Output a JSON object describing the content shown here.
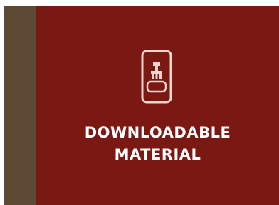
{
  "card": {
    "title_line1": "DOWNLOADABLE",
    "title_line2": "MATERIAL",
    "icon": "stamp-icon",
    "colors": {
      "background": "#7a1914",
      "edge_strip": "#5e4a34",
      "text": "#ffffff"
    }
  }
}
